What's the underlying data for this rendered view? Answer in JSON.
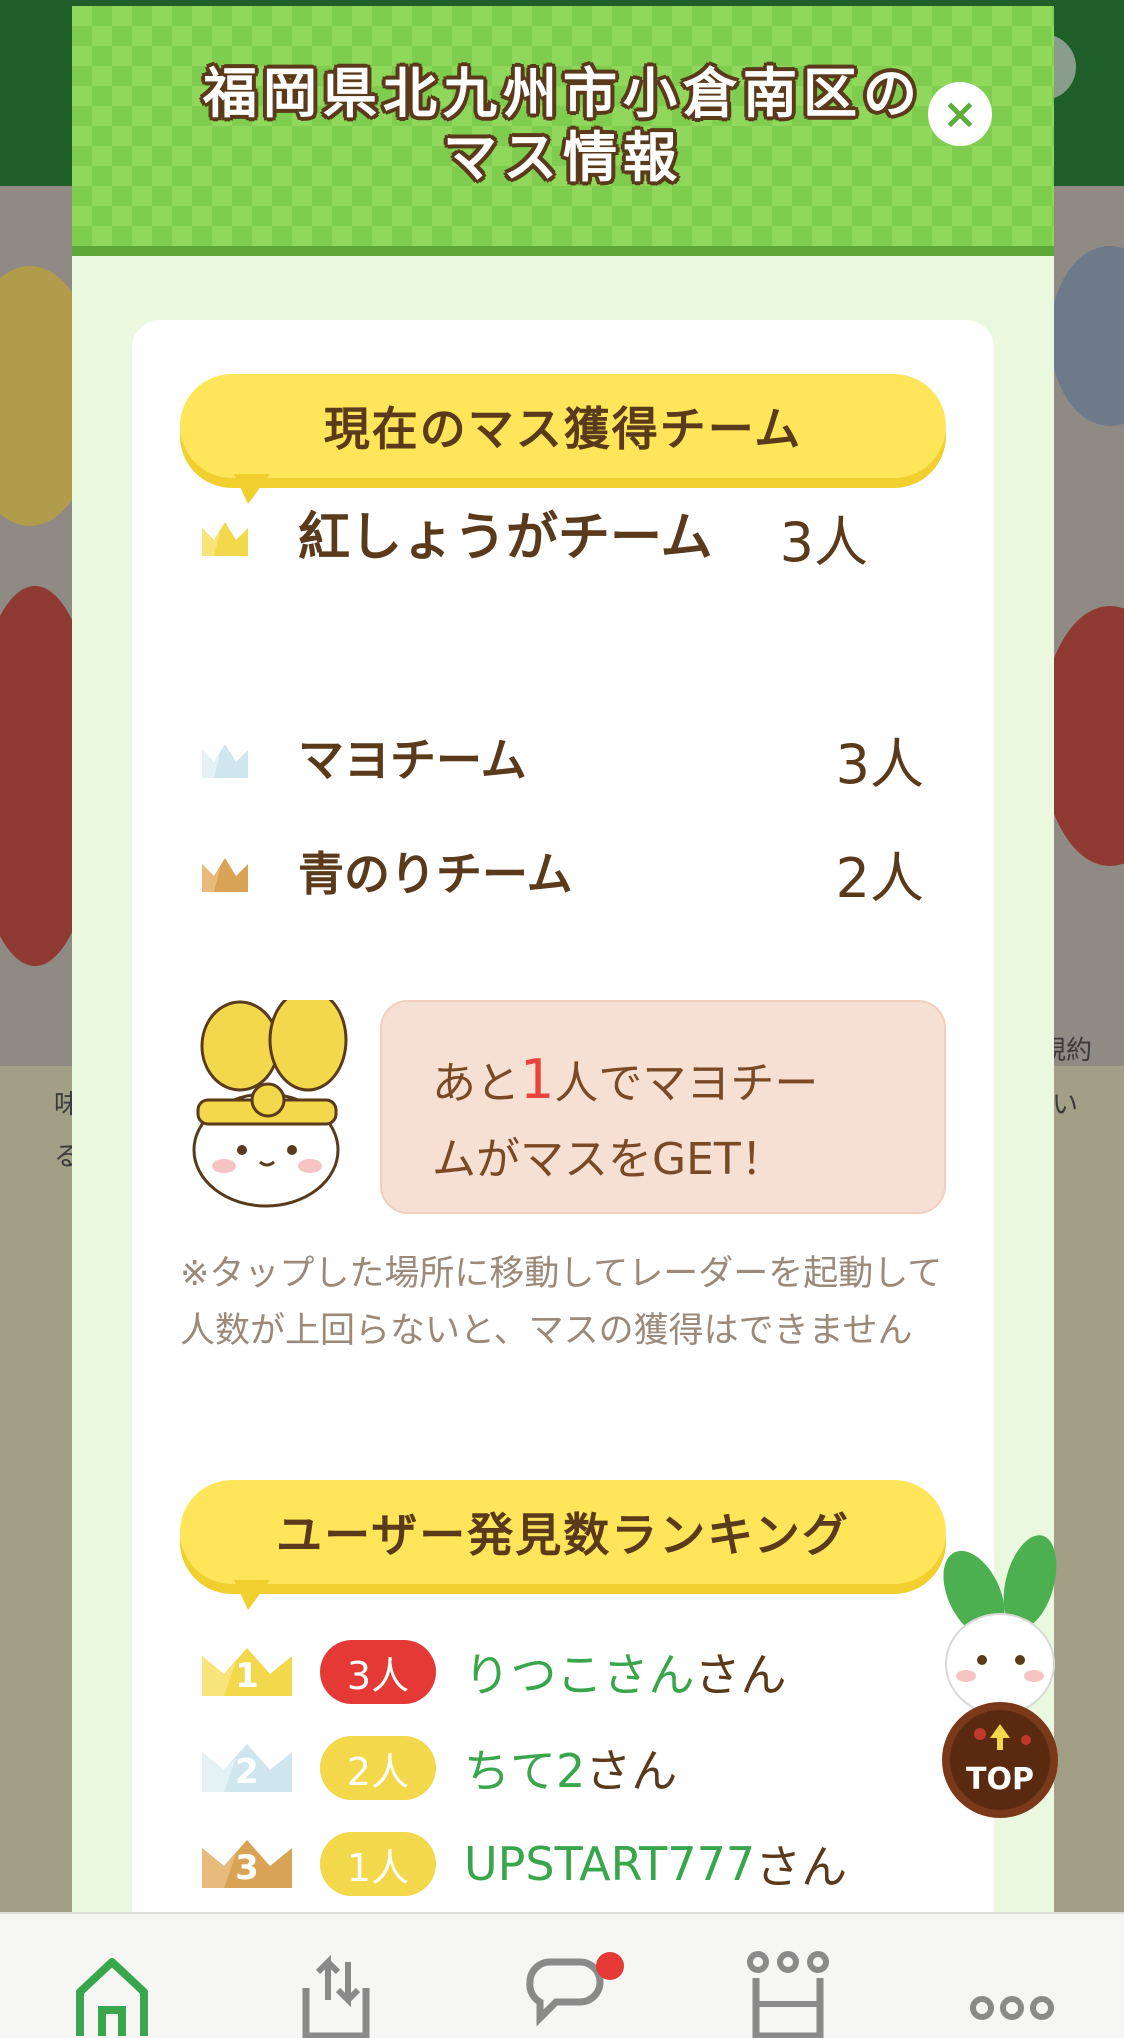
{
  "modal": {
    "title": "福岡県北九州市小倉南区の\nマス情報",
    "close_label": "×"
  },
  "current_teams": {
    "heading": "現在のマス獲得チーム",
    "teams": [
      {
        "rank": 1,
        "name": "紅しょうがチーム",
        "count": "3人",
        "crown": "gold"
      },
      {
        "rank": 2,
        "name": "マヨチーム",
        "count": "3人",
        "crown": "silver"
      },
      {
        "rank": 3,
        "name": "青のりチーム",
        "count": "2人",
        "crown": "bronze"
      }
    ]
  },
  "message": {
    "prefix": "あと",
    "number": "1",
    "suffix": "人でマヨチー\nムがマスをGET！"
  },
  "note": "※タップした場所に移動してレーダーを起動して人数が上回らないと、マスの獲得はできません",
  "ranking": {
    "heading": "ユーザー発見数ランキング",
    "users": [
      {
        "rank": "1",
        "count": "3人",
        "name": "りつこさん",
        "suffix": "さん"
      },
      {
        "rank": "2",
        "count": "2人",
        "name": "ちて2",
        "suffix": "さん"
      },
      {
        "rank": "3",
        "count": "1人",
        "name": "UPSTART777",
        "suffix": "さん"
      }
    ]
  },
  "top_button": {
    "label": "TOP"
  },
  "background": {
    "left_snippets": [
      "味",
      "る"
    ],
    "right_snippets": [
      "規約",
      "い"
    ]
  },
  "colors": {
    "header_green": "#8fd85c",
    "banner_yellow": "#ffe55a",
    "user_green": "#3aa64c",
    "accent_red": "#e53935",
    "text_brown": "#5a3a1a",
    "gold": "#f2d84a",
    "silver": "#cfe6ee",
    "bronze": "#d9a356"
  },
  "tabs": [
    {
      "icon": "home-icon",
      "active": true
    },
    {
      "icon": "upload-icon",
      "active": false
    },
    {
      "icon": "chat-icon",
      "active": false,
      "badge": true
    },
    {
      "icon": "ranking-crown-icon",
      "active": false
    },
    {
      "icon": "more-icon",
      "active": false
    }
  ]
}
